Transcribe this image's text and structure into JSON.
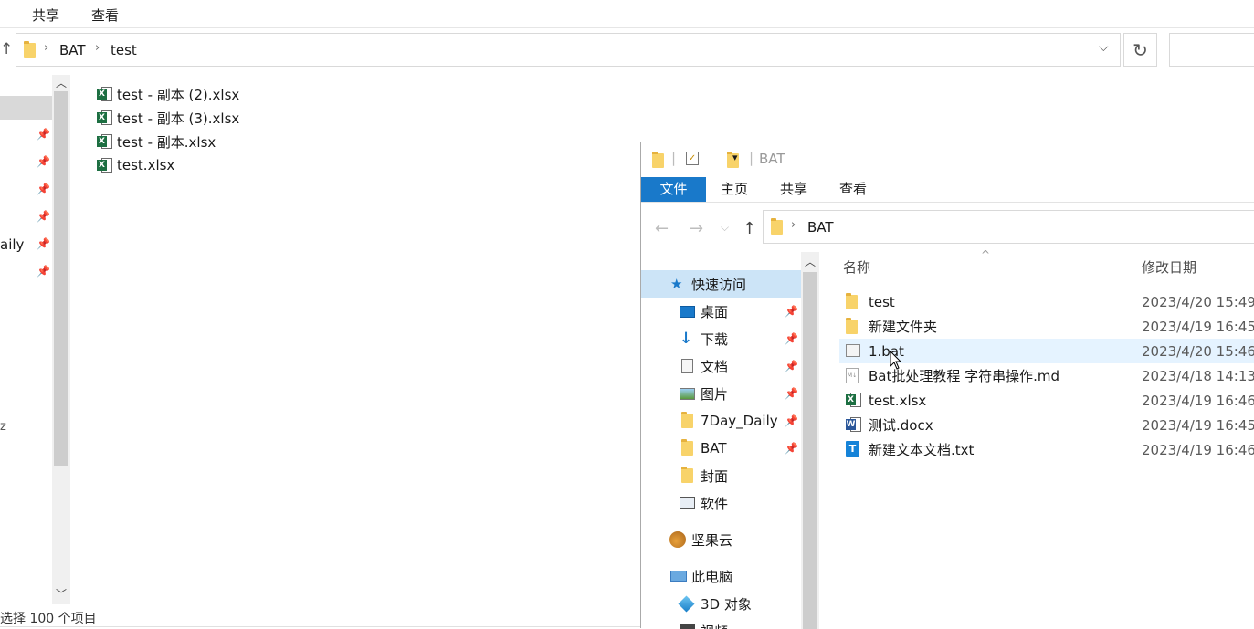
{
  "background_window": {
    "menu": {
      "share": "共享",
      "view": "查看"
    },
    "breadcrumb": [
      "BAT",
      "test"
    ],
    "nav_partial_labels": {
      "item_daily": "aily",
      "item_partial": "z"
    },
    "files": [
      {
        "name": "test - 副本 (2).xlsx"
      },
      {
        "name": "test - 副本 (3).xlsx"
      },
      {
        "name": "test - 副本.xlsx"
      },
      {
        "name": "test.xlsx"
      }
    ],
    "status": "选择 100 个项目"
  },
  "window": {
    "title": "BAT",
    "ribbon": {
      "file": "文件",
      "home": "主页",
      "share": "共享",
      "view": "查看"
    },
    "breadcrumb": [
      "BAT"
    ],
    "tree": {
      "quick_access": "快速访问",
      "desktop": "桌面",
      "downloads": "下载",
      "documents": "文档",
      "pictures": "图片",
      "daily": "7Day_Daily",
      "bat": "BAT",
      "cover": "封面",
      "software": "软件",
      "jianguoyun": "坚果云",
      "this_pc": "此电脑",
      "objects3d": "3D 对象",
      "videos": "视频"
    },
    "columns": {
      "name": "名称",
      "date": "修改日期"
    },
    "files": [
      {
        "name": "test",
        "date": "2023/4/20 15:49",
        "icon": "folder-icon"
      },
      {
        "name": "新建文件夹",
        "date": "2023/4/19 16:45",
        "icon": "folder-icon"
      },
      {
        "name": "1.bat",
        "date": "2023/4/20 15:46",
        "icon": "bat-file-icon"
      },
      {
        "name": "Bat批处理教程 字符串操作.md",
        "date": "2023/4/18 14:13",
        "icon": "markdown-file-icon"
      },
      {
        "name": "test.xlsx",
        "date": "2023/4/19 16:46",
        "icon": "excel-file-icon"
      },
      {
        "name": "测试.docx",
        "date": "2023/4/19 16:45",
        "icon": "word-file-icon"
      },
      {
        "name": "新建文本文档.txt",
        "date": "2023/4/19 16:46",
        "icon": "text-file-icon"
      }
    ]
  },
  "colors": {
    "accent": "#1979ca",
    "selection": "#cce4f7",
    "hover": "#e5f3ff"
  }
}
